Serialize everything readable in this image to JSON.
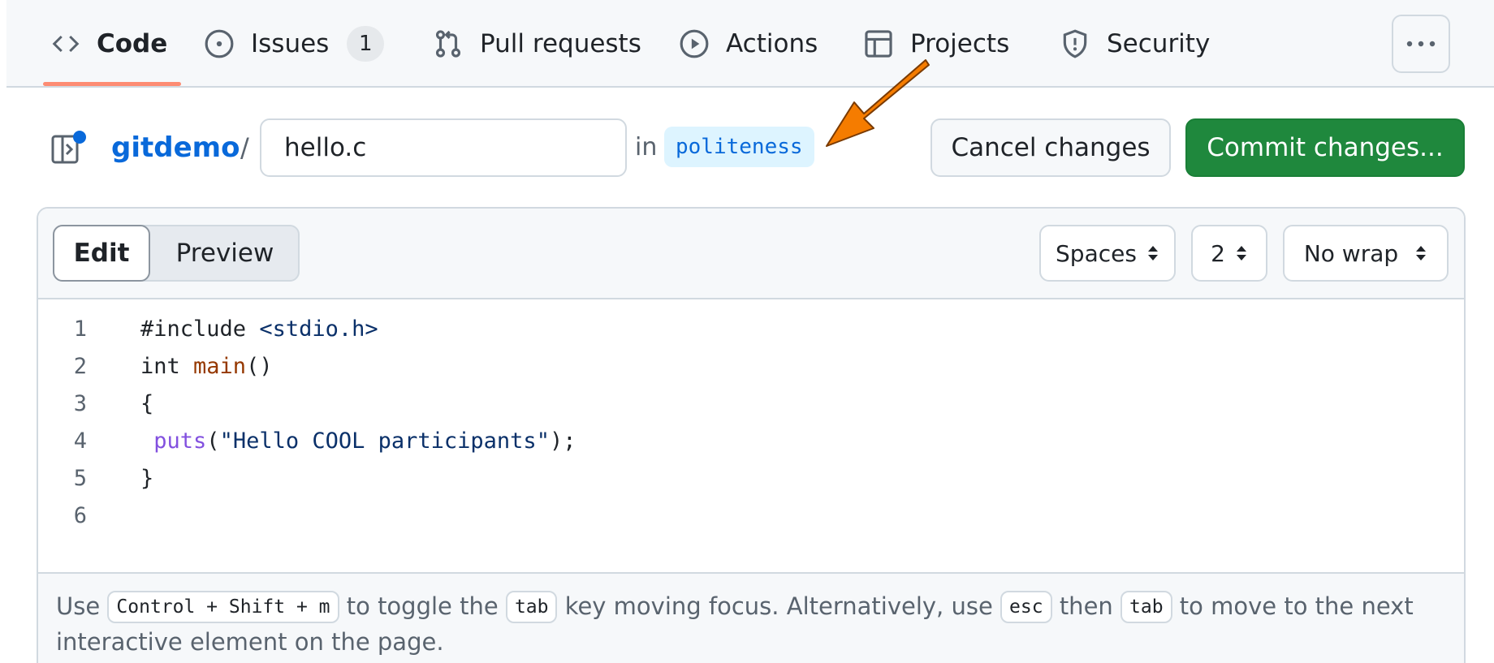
{
  "nav": {
    "items": [
      {
        "label": "Code",
        "icon": "code-icon",
        "active": true
      },
      {
        "label": "Issues",
        "icon": "issue-opened-icon",
        "count": "1"
      },
      {
        "label": "Pull requests",
        "icon": "git-pull-request-icon"
      },
      {
        "label": "Actions",
        "icon": "play-icon"
      },
      {
        "label": "Projects",
        "icon": "table-icon"
      },
      {
        "label": "Security",
        "icon": "shield-icon"
      }
    ],
    "more_icon": "kebab-horizontal-icon"
  },
  "breadcrumb": {
    "repo": "gitdemo",
    "separator": "/",
    "filename": "hello.c",
    "in_label": "in",
    "branch": "politeness"
  },
  "actions": {
    "cancel": "Cancel changes",
    "commit": "Commit changes..."
  },
  "editor": {
    "tabs": {
      "edit": "Edit",
      "preview": "Preview"
    },
    "indent_mode": "Spaces",
    "indent_size": "2",
    "wrap_mode": "No wrap",
    "lines": [
      {
        "n": "1",
        "parts": [
          [
            "plain",
            "#include "
          ],
          [
            "str",
            "<stdio.h>"
          ]
        ]
      },
      {
        "n": "2",
        "parts": [
          [
            "plain",
            "int "
          ],
          [
            "fn",
            "main"
          ],
          [
            "plain",
            "()"
          ]
        ]
      },
      {
        "n": "3",
        "parts": [
          [
            "plain",
            "{"
          ]
        ]
      },
      {
        "n": "4",
        "parts": [
          [
            "plain",
            " "
          ],
          [
            "call",
            "puts"
          ],
          [
            "plain",
            "("
          ],
          [
            "str",
            "\"Hello COOL participants\""
          ],
          [
            "plain",
            ");"
          ]
        ]
      },
      {
        "n": "5",
        "parts": [
          [
            "plain",
            "}"
          ]
        ]
      },
      {
        "n": "6",
        "parts": []
      }
    ],
    "footer": {
      "t1": "Use",
      "k1": "Control + Shift + m",
      "t2": "to toggle the",
      "k2": "tab",
      "t3": "key moving focus. Alternatively, use",
      "k3": "esc",
      "t4": "then",
      "k4": "tab",
      "t5": "to move to the next interactive element on the page."
    }
  },
  "colors": {
    "accent": "#0969da",
    "commit_green": "#1f883d",
    "annotation_arrow": "#f57c00",
    "active_tab_underline": "#fd8c73"
  }
}
